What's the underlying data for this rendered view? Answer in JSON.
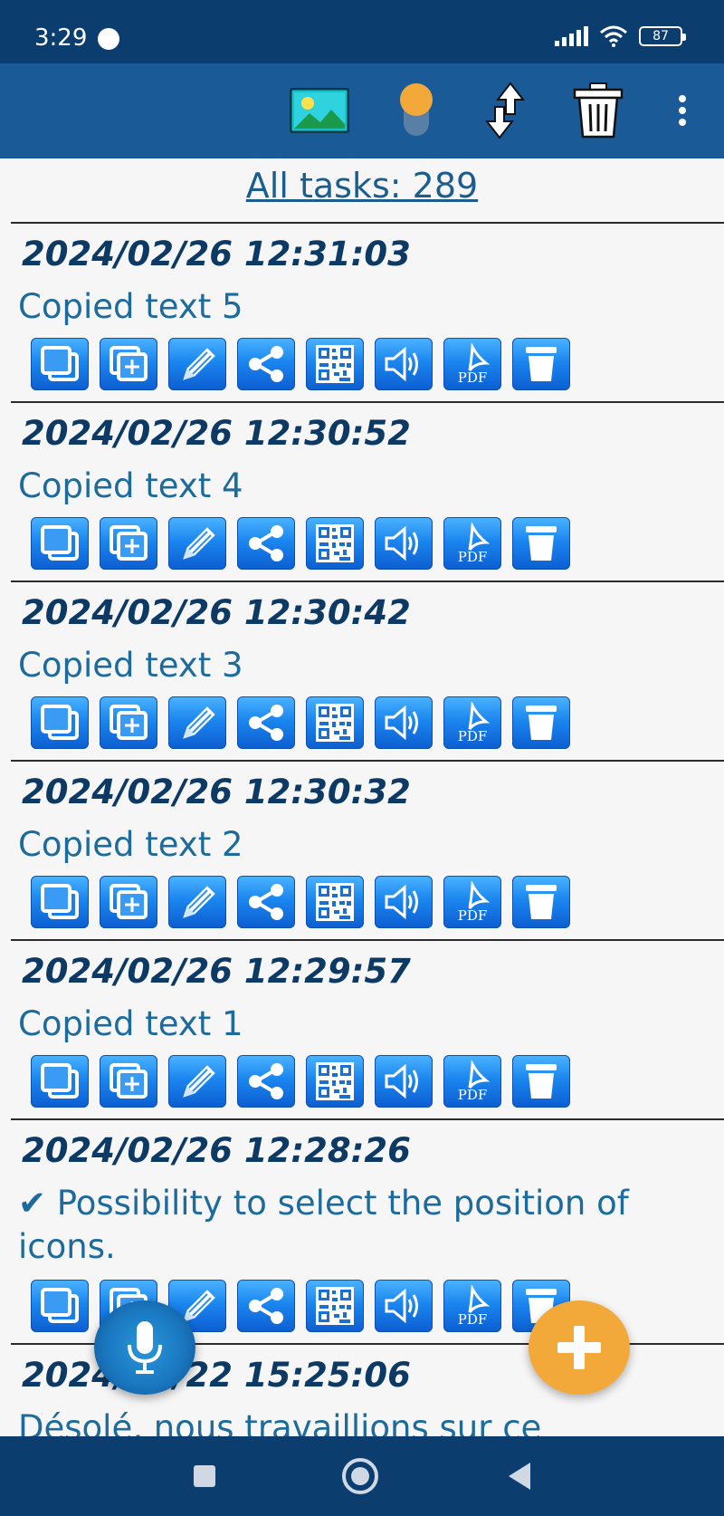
{
  "status_bar": {
    "time": "3:29",
    "battery": "87"
  },
  "app_bar": {
    "icons": [
      "image-icon",
      "toggle-icon",
      "sort-icon",
      "trash-icon",
      "more-vertical-icon"
    ]
  },
  "total_label": "All tasks: 289",
  "action_icons": [
    "copy-icon",
    "copy-add-icon",
    "edit-pencil-icon",
    "share-icon",
    "qr-code-icon",
    "speaker-icon",
    "pdf-icon",
    "delete-icon"
  ],
  "colors": {
    "status_bar": "#0b3d6e",
    "app_bar": "#1a5a96",
    "accent_fab": "#f2a93a",
    "timestamp": "#0d3a64",
    "text": "#1d6b9c"
  },
  "tasks": [
    {
      "timestamp": "2024/02/26 12:31:03",
      "text": "Copied text 5"
    },
    {
      "timestamp": "2024/02/26 12:30:52",
      "text": "Copied text 4"
    },
    {
      "timestamp": "2024/02/26 12:30:42",
      "text": "Copied text 3"
    },
    {
      "timestamp": "2024/02/26 12:30:32",
      "text": "Copied text 2"
    },
    {
      "timestamp": "2024/02/26 12:29:57",
      "text": "Copied text 1"
    },
    {
      "timestamp": "2024/02/26 12:28:26",
      "text": "✔ Possibility to select the position of icons."
    },
    {
      "timestamp": "2024/02/22 15:25:06",
      "text": "Désolé, nous travaillions sur ce"
    }
  ]
}
